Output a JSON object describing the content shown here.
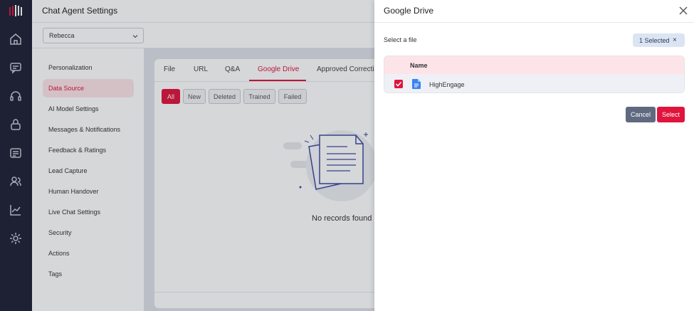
{
  "app": {
    "page_title": "Chat Agent Settings",
    "agent_select_value": "Rebecca",
    "brand_color": "#e0143c"
  },
  "rail": {
    "icons": [
      "logo-icon",
      "home-icon",
      "chat-icon",
      "headset-icon",
      "bot-icon",
      "knowledge-icon",
      "users-icon",
      "analytics-icon",
      "settings-icon"
    ]
  },
  "settings_nav": {
    "items": [
      {
        "label": "Personalization"
      },
      {
        "label": "Data Source",
        "active": true
      },
      {
        "label": "AI Model Settings"
      },
      {
        "label": "Messages & Notifications"
      },
      {
        "label": "Feedback & Ratings"
      },
      {
        "label": "Lead Capture"
      },
      {
        "label": "Human Handover"
      },
      {
        "label": "Live Chat Settings"
      },
      {
        "label": "Security"
      },
      {
        "label": "Actions"
      },
      {
        "label": "Tags"
      }
    ]
  },
  "data_source": {
    "tabs": [
      "File",
      "URL",
      "Q&A",
      "Google Drive",
      "Approved Correctio"
    ],
    "active_tab": "Google Drive",
    "filters": [
      "All",
      "New",
      "Deleted",
      "Trained",
      "Failed"
    ],
    "active_filter": "All",
    "empty_text": "No records found"
  },
  "drawer": {
    "title": "Google Drive",
    "select_label": "Select a file",
    "selected_badge": "1 Selected",
    "badge_clear": "×",
    "table_header_name": "Name",
    "files": [
      {
        "name": "HighEngage",
        "checked": true,
        "icon": "google-doc-icon"
      }
    ],
    "cancel_label": "Cancel",
    "select_label_btn": "Select"
  }
}
